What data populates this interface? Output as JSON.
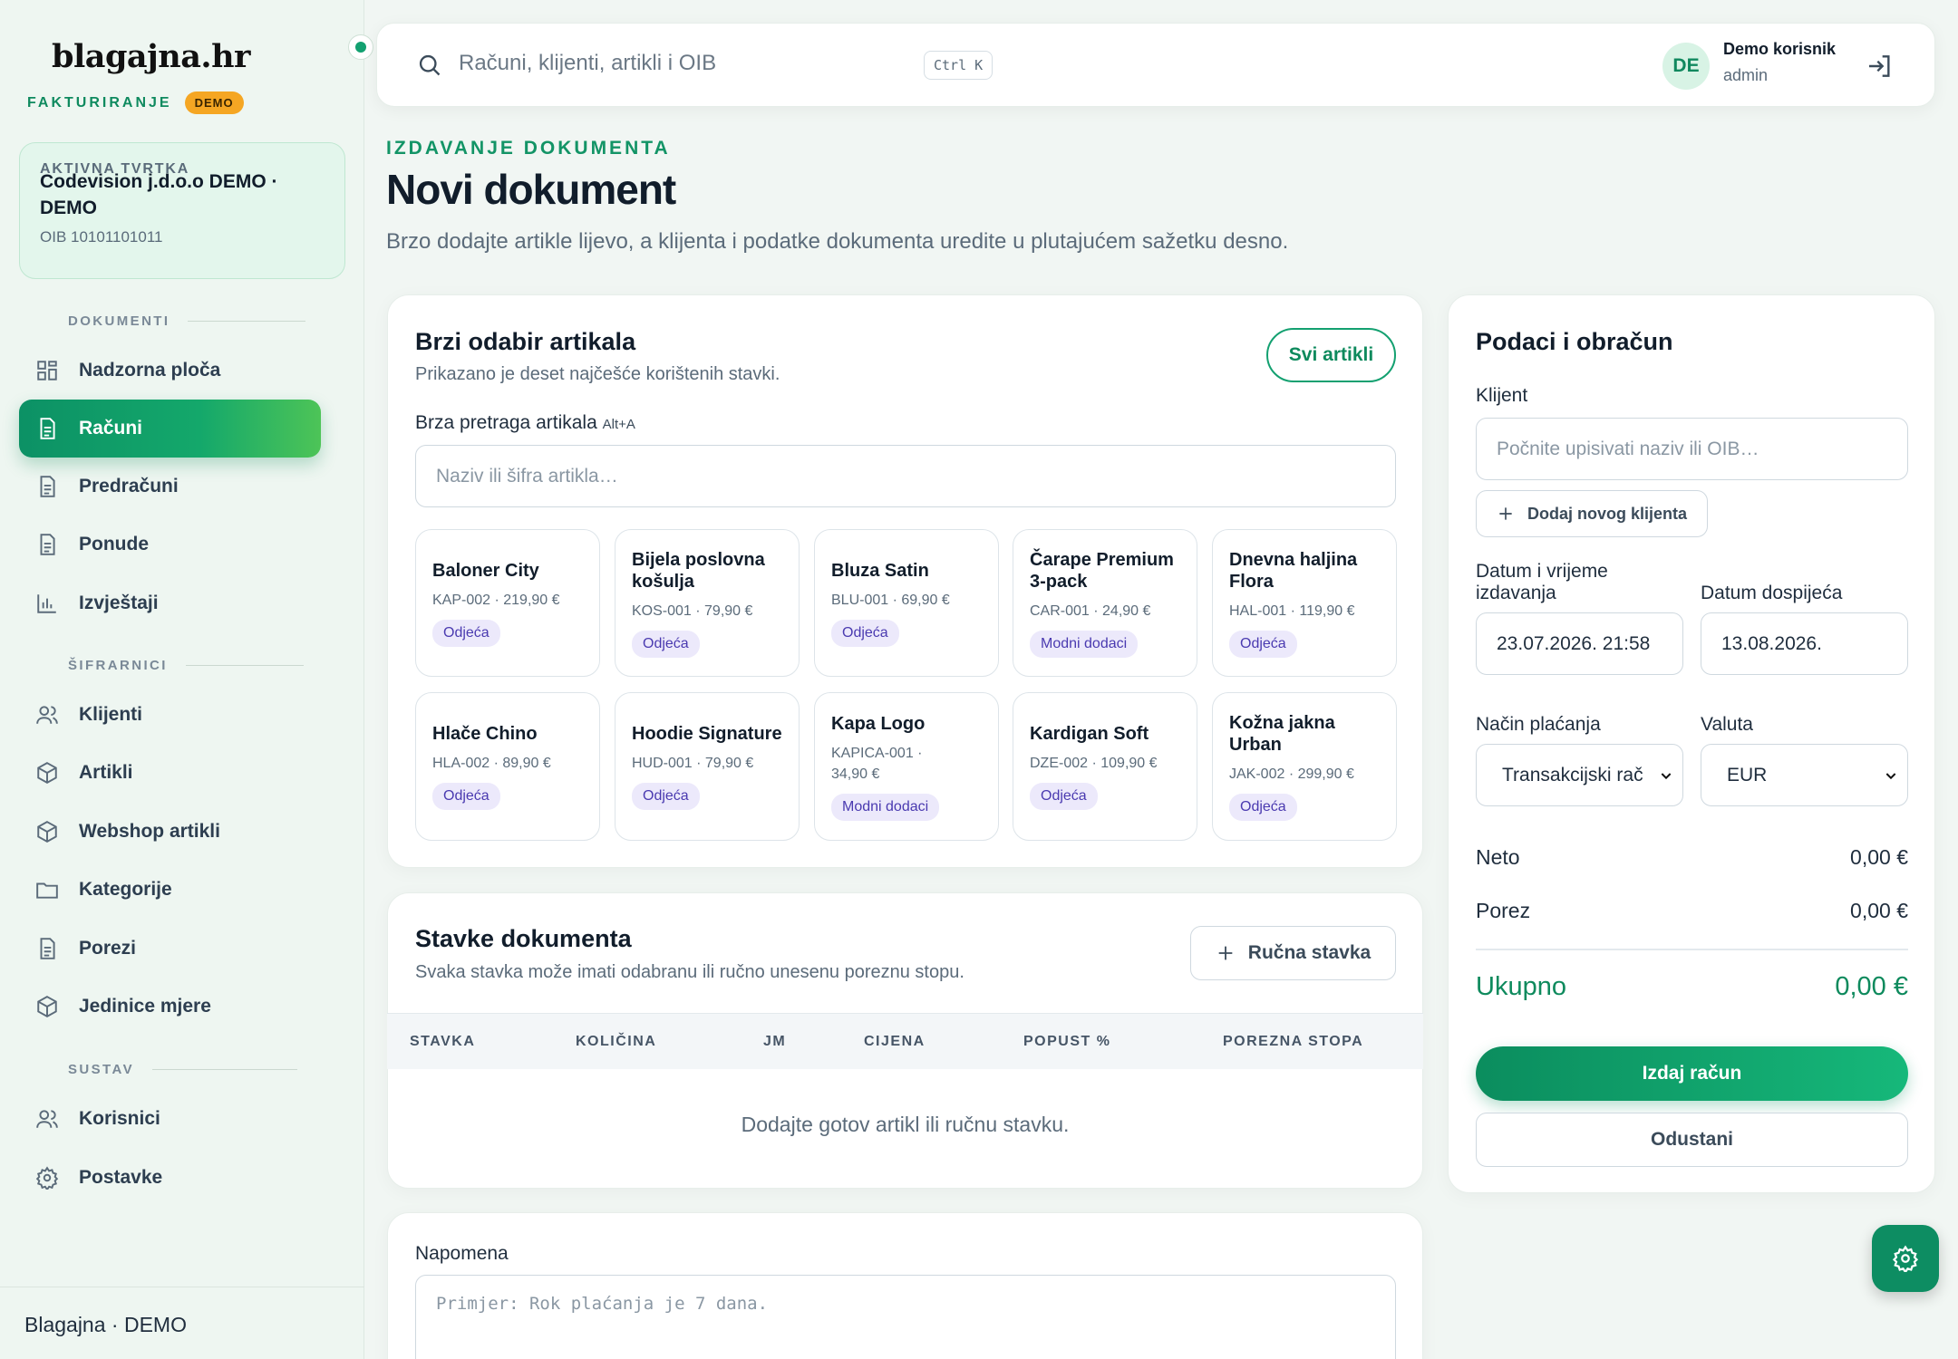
{
  "brand": {
    "logo": "blagajna.hr",
    "tag": "FAKTURIRANJE",
    "badge": "DEMO"
  },
  "company": {
    "label": "AKTIVNA TVRTKA",
    "name": "Codevision j.d.o.o DEMO · DEMO",
    "oib": "OIB 10101101011"
  },
  "sidebar": {
    "sections": {
      "documents": "DOKUMENTI",
      "codebooks": "ŠIFRARNICI",
      "system": "SUSTAV"
    },
    "items": [
      {
        "label": "Nadzorna ploča",
        "icon": "dashboard-icon"
      },
      {
        "label": "Računi",
        "icon": "document-icon",
        "active": true
      },
      {
        "label": "Predračuni",
        "icon": "document-icon"
      },
      {
        "label": "Ponude",
        "icon": "document-icon"
      },
      {
        "label": "Izvještaji",
        "icon": "chart-icon"
      },
      {
        "label": "Klijenti",
        "icon": "users-icon"
      },
      {
        "label": "Artikli",
        "icon": "box-icon"
      },
      {
        "label": "Webshop artikli",
        "icon": "box-icon"
      },
      {
        "label": "Kategorije",
        "icon": "folder-icon"
      },
      {
        "label": "Porezi",
        "icon": "document-icon"
      },
      {
        "label": "Jedinice mjere",
        "icon": "box-icon"
      },
      {
        "label": "Korisnici",
        "icon": "users-icon"
      },
      {
        "label": "Postavke",
        "icon": "gear-icon"
      }
    ],
    "footer": "Blagajna · DEMO"
  },
  "topbar": {
    "search_placeholder": "Računi, klijenti, artikli i OIB",
    "shortcut": "Ctrl K",
    "user": {
      "initials": "DE",
      "name": "Demo korisnik",
      "role": "admin"
    }
  },
  "header": {
    "eyebrow": "IZDAVANJE DOKUMENTA",
    "title": "Novi dokument",
    "subtitle": "Brzo dodajte artikle lijevo, a klijenta i podatke dokumenta uredite u plutajućem sažetku desno."
  },
  "quick_pick": {
    "title": "Brzi odabir artikala",
    "subtitle": "Prikazano je deset najčešće korištenih stavki.",
    "all_button": "Svi artikli",
    "search_label": "Brza pretraga artikala",
    "search_shortcut": "Alt+A",
    "search_placeholder": "Naziv ili šifra artikla…",
    "articles": [
      {
        "name": "Baloner City",
        "meta": "KAP-002 · 219,90 €",
        "category": "Odjeća"
      },
      {
        "name": "Bijela poslovna košulja",
        "meta": "KOS-001 · 79,90 €",
        "category": "Odjeća"
      },
      {
        "name": "Bluza Satin",
        "meta": "BLU-001 · 69,90 €",
        "category": "Odjeća"
      },
      {
        "name": "Čarape Premium 3-pack",
        "meta": "CAR-001 · 24,90 €",
        "category": "Modni dodaci"
      },
      {
        "name": "Dnevna haljina Flora",
        "meta": "HAL-001 · 119,90 €",
        "category": "Odjeća"
      },
      {
        "name": "Hlače Chino",
        "meta": "HLA-002 · 89,90 €",
        "category": "Odjeća"
      },
      {
        "name": "Hoodie Signature",
        "meta": "HUD-001 · 79,90 €",
        "category": "Odjeća"
      },
      {
        "name": "Kapa Logo",
        "meta": "KAPICA-001 · 34,90 €",
        "category": "Modni dodaci"
      },
      {
        "name": "Kardigan Soft",
        "meta": "DZE-002 · 109,90 €",
        "category": "Odjeća"
      },
      {
        "name": "Kožna jakna Urban",
        "meta": "JAK-002 · 299,90 €",
        "category": "Odjeća"
      }
    ]
  },
  "items": {
    "title": "Stavke dokumenta",
    "subtitle": "Svaka stavka može imati odabranu ili ručno unesenu poreznu stopu.",
    "manual_button": "Ručna stavka",
    "columns": [
      "STAVKA",
      "KOLIČINA",
      "JM",
      "CIJENA",
      "POPUST %",
      "POREZNA STOPA"
    ],
    "empty": "Dodajte gotov artikl ili ručnu stavku."
  },
  "note": {
    "label": "Napomena",
    "placeholder": "Primjer: Rok plaćanja je 7 dana."
  },
  "summary": {
    "title": "Podaci i obračun",
    "client_label": "Klijent",
    "client_placeholder": "Počnite upisivati naziv ili OIB…",
    "add_client": "Dodaj novog klijenta",
    "issue_date_label": "Datum i vrijeme izdavanja",
    "issue_date": "23.07.2026. 21:58",
    "due_date_label": "Datum dospijeća",
    "due_date": "13.08.2026.",
    "payment_label": "Način plaćanja",
    "payment_value": "Transakcijski rač",
    "currency_label": "Valuta",
    "currency_value": "EUR",
    "net_label": "Neto",
    "net": "0,00 €",
    "tax_label": "Porez",
    "tax": "0,00 €",
    "total_label": "Ukupno",
    "total": "0,00 €",
    "issue_button": "Izdaj račun",
    "cancel_button": "Odustani"
  },
  "colors": {
    "accent": "#13a070",
    "badge": "#f5a623"
  }
}
